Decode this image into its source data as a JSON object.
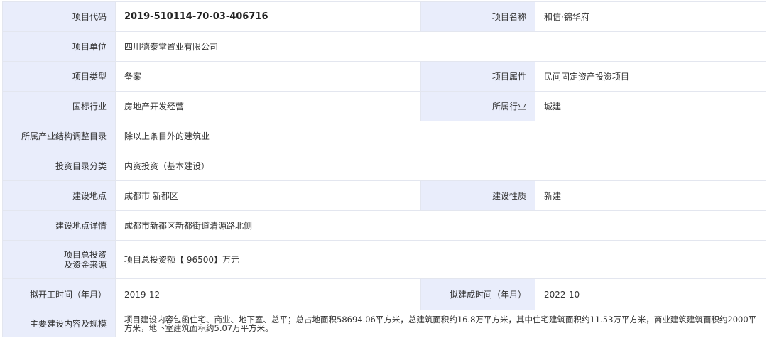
{
  "rows": {
    "project_code": {
      "label": "项目代码",
      "value": "2019-510114-70-03-406716"
    },
    "project_name": {
      "label": "项目名称",
      "value": "和信·锦华府"
    },
    "project_unit": {
      "label": "项目单位",
      "value": "四川德泰堂置业有限公司"
    },
    "project_type": {
      "label": "项目类型",
      "value": "备案"
    },
    "project_attribute": {
      "label": "项目属性",
      "value": "民间固定资产投资项目"
    },
    "national_industry": {
      "label": "国标行业",
      "value": "房地产开发经营"
    },
    "industry": {
      "label": "所属行业",
      "value": "城建"
    },
    "industry_catalog": {
      "label": "所属产业结构调整目录",
      "value": "除以上条目外的建筑业"
    },
    "investment_catalog": {
      "label": "投资目录分类",
      "value": "内资投资（基本建设）"
    },
    "construction_site": {
      "label": "建设地点",
      "value": "成都市 新都区"
    },
    "construction_nature": {
      "label": "建设性质",
      "value": "新建"
    },
    "site_detail": {
      "label": "建设地点详情",
      "value": "成都市新都区新都街道清源路北侧"
    },
    "total_investment": {
      "label_line1": "项目总投资",
      "label_line2": "及资金来源",
      "value": "项目总投资额【 96500】万元"
    },
    "planned_start": {
      "label": "拟开工时间（年月）",
      "value": "2019-12"
    },
    "planned_completion": {
      "label": "拟建成时间（年月）",
      "value": "2022-10"
    },
    "main_content": {
      "label": "主要建设内容及规模",
      "value": "项目建设内容包函住宅、商业、地下室、总平；总占地面积58694.06平方米，总建筑面积约16.8万平方米，其中住宅建筑面积约11.53万平方米，商业建筑建筑面积约2000平方米，地下室建筑面积约5.07万平方米。"
    }
  }
}
